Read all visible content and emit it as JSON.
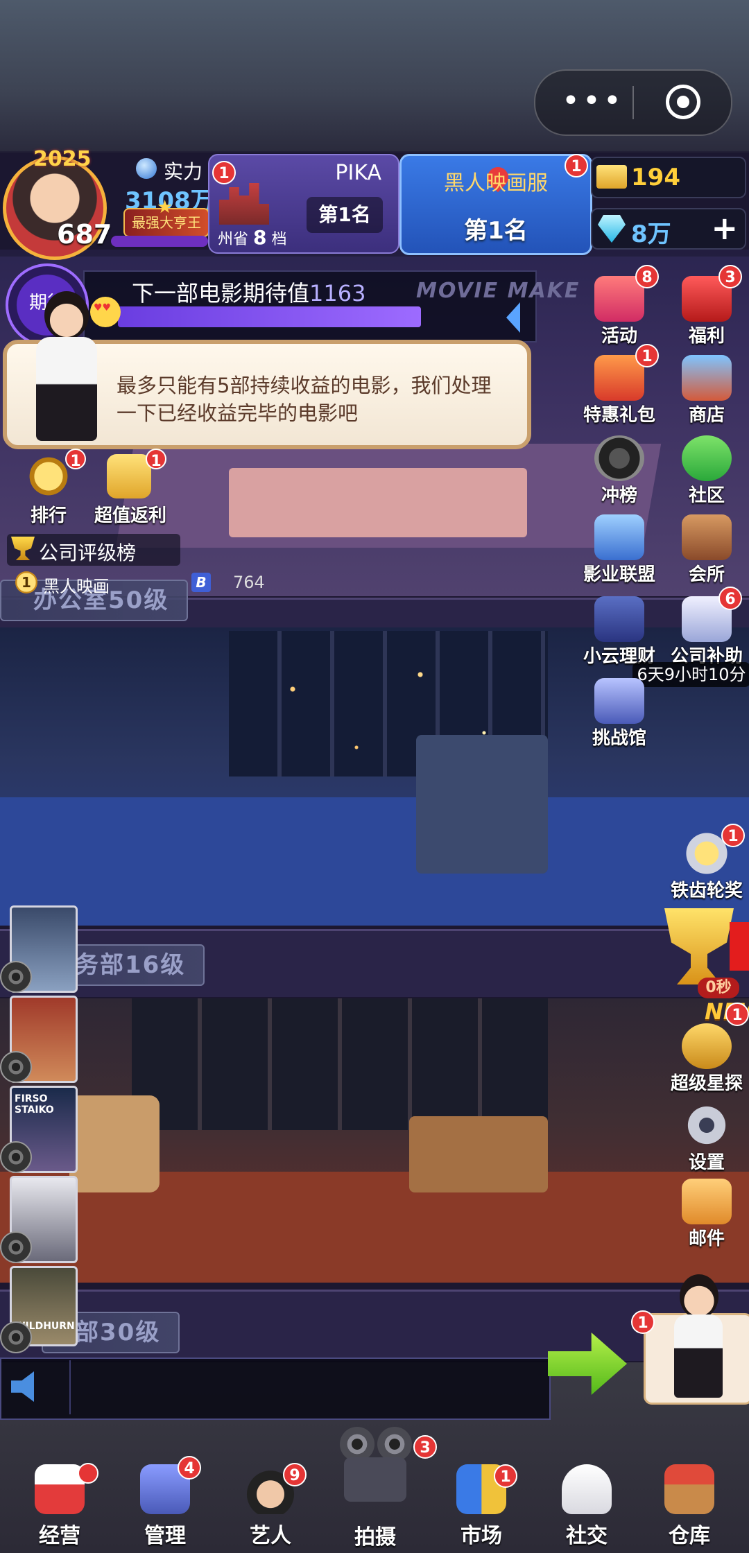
{
  "top_capsule": {
    "more": "•••"
  },
  "player": {
    "year_badge": "2025",
    "level": "687",
    "power_label": "实力",
    "power_value": "3108万",
    "title": "最强大亨王"
  },
  "rank_panel": {
    "name": "PIKA",
    "region": "州省",
    "tier_number": "8",
    "tier_unit": "档",
    "rank": "第1名",
    "badge": "1"
  },
  "server_panel": {
    "name": "黑人映画服",
    "rank": "第1名",
    "badge": "1"
  },
  "resources": {
    "tickets": "194",
    "gems": "8万",
    "add": "+"
  },
  "expectation": {
    "circle_label": "期待",
    "label": "下一部电影期待值",
    "value": "1163",
    "fill_fraction": 0.78,
    "bg_sign": "MOVIE MAKE"
  },
  "dialog": {
    "text": "最多只能有5部持续收益的电影，我们处理一下已经收益完毕的电影吧"
  },
  "left_buttons": [
    {
      "label": "排行",
      "badge": "1"
    },
    {
      "label": "超值返利",
      "badge": "1"
    }
  ],
  "company": {
    "board_title": "公司评级榜",
    "rank": "1",
    "name": "黑人映画",
    "logo_letter": "B",
    "score": "764"
  },
  "floors": [
    {
      "label": "办公室50级"
    },
    {
      "label": "务部16级"
    },
    {
      "label": "部30级"
    }
  ],
  "right_buttons": [
    {
      "label": "活动",
      "badge": "8"
    },
    {
      "label": "福利",
      "badge": "3"
    },
    {
      "label": "特惠礼包",
      "badge": "1"
    },
    {
      "label": "商店",
      "badge": ""
    },
    {
      "label": "冲榜",
      "badge": ""
    },
    {
      "label": "社区",
      "badge": ""
    },
    {
      "label": "影业联盟",
      "badge": ""
    },
    {
      "label": "会所",
      "badge": ""
    },
    {
      "label": "小云理财",
      "badge": ""
    },
    {
      "label": "公司补助",
      "badge": "6"
    },
    {
      "label": "挑战馆",
      "badge": ""
    },
    {
      "label": "铁齿轮奖",
      "badge": "1"
    },
    {
      "label": "超级星探",
      "badge": "1"
    },
    {
      "label": "设置",
      "badge": ""
    },
    {
      "label": "邮件",
      "badge": ""
    }
  ],
  "subsidy_timer": "6天9小时10分",
  "trophy_timer": "0秒",
  "new_label": "NEW",
  "posters": [
    {
      "title": ""
    },
    {
      "title": ""
    },
    {
      "title": "FIRSO STAIKO"
    },
    {
      "title": ""
    },
    {
      "title": "WILDHURN"
    }
  ],
  "assistant_badge": "1",
  "nav": [
    {
      "label": "经营",
      "badge": ""
    },
    {
      "label": "管理",
      "badge": "4"
    },
    {
      "label": "艺人",
      "badge": "9"
    },
    {
      "label": "拍摄",
      "badge": "3"
    },
    {
      "label": "市场",
      "badge": "1"
    },
    {
      "label": "社交",
      "badge": ""
    },
    {
      "label": "仓库",
      "badge": ""
    }
  ],
  "colors": {
    "badge_red": "#e53535",
    "power_blue": "#6fc4ff",
    "gold": "#ffcf3a",
    "expect_purple": "#9d6bff"
  }
}
